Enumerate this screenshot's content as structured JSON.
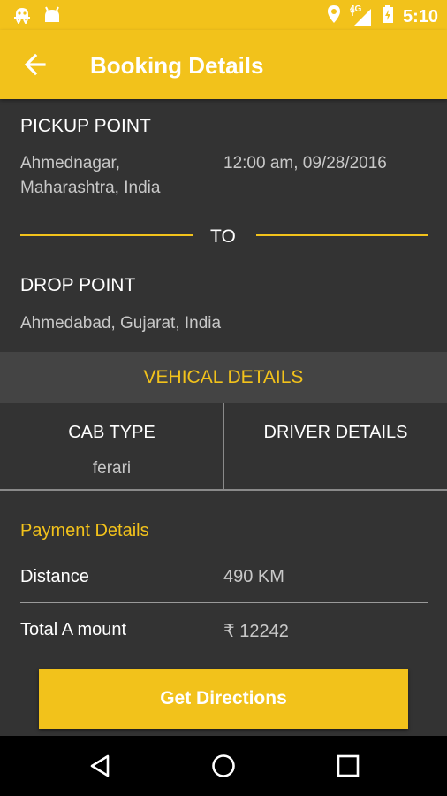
{
  "status_bar": {
    "time": "5:10",
    "network": "4G",
    "icons": [
      "ghost-icon",
      "android-icon",
      "location-icon",
      "signal-icon",
      "battery-icon"
    ]
  },
  "app_bar": {
    "title": "Booking Details",
    "back_icon": "arrow-left-icon",
    "color": "#f2c21b"
  },
  "pickup": {
    "heading": "PICKUP POINT",
    "address_line1": "Ahmednagar,",
    "address_line2": "Maharashtra, India",
    "datetime": "12:00 am, 09/28/2016"
  },
  "separator": {
    "label": "TO"
  },
  "drop": {
    "heading": "DROP POINT",
    "address": "Ahmedabad, Gujarat, India"
  },
  "vehicle": {
    "heading": "VEHICAL DETAILS",
    "cab_type_label": "CAB TYPE",
    "cab_type_value": "ferari",
    "driver_label": "DRIVER DETAILS"
  },
  "payment": {
    "heading": "Payment Details",
    "distance_label": "Distance",
    "distance_value": "490 KM",
    "amount_label": "Total A mount",
    "amount_value": "₹ 12242"
  },
  "action": {
    "label": "Get Directions"
  },
  "nav_bar": {
    "icons": [
      "back-triangle-icon",
      "home-circle-icon",
      "recents-square-icon"
    ]
  }
}
